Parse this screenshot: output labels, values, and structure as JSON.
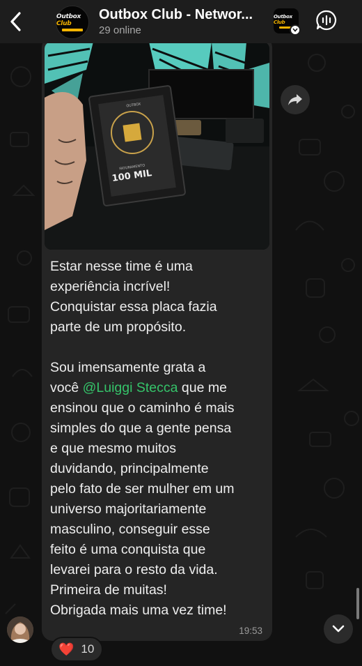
{
  "header": {
    "title": "Outbox Club - Networ...",
    "subtitle": "29 online",
    "logo": {
      "word": "Outbox",
      "club": "Club"
    }
  },
  "message": {
    "photo": {
      "plaque_title": "100 MIL",
      "plaque_caption": "FATURAMENTO",
      "plaque_brand": "OUTBOX"
    },
    "text_before_mention": "Estar nesse time é uma\nexperiência incrível!\nConquistar essa placa fazia\nparte de um propósito.\n\nSou imensamente grata a\nvocê ",
    "mention": "@Luiggi Stecca",
    "text_after_mention": " que me\nensinou que o caminho é mais\nsimples do que a gente pensa\ne que mesmo muitos\nduvidando, principalmente\npelo fato de ser mulher em um\nuniverso majoritariamente\nmasculino, conseguir esse\nfeito é uma conquista que\nlevarei para o resto da vida.\nPrimeira de muitas!\nObrigada mais uma vez time!",
    "time": "19:53"
  },
  "reaction": {
    "emoji": "❤️",
    "count": "10"
  },
  "icons": {
    "back": "chevron-left-icon",
    "voice": "voice-chat-icon",
    "forward": "forward-icon",
    "scroll_down": "chevron-down-icon",
    "mention_color": "#35c46a"
  }
}
